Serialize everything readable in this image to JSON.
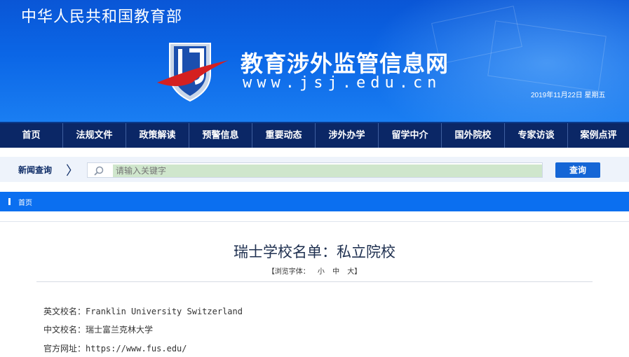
{
  "header": {
    "ministry": "中华人民共和国教育部",
    "site_title": "教育涉外监管信息网",
    "site_url": "www.jsj.edu.cn",
    "date": "2019年11月22日  星期五",
    "logo_icon": "jsj-logo-icon"
  },
  "nav": {
    "items": [
      "首页",
      "法规文件",
      "政策解读",
      "预警信息",
      "重要动态",
      "涉外办学",
      "留学中介",
      "国外院校",
      "专家访谈",
      "案例点评"
    ]
  },
  "search": {
    "label": "新闻查询",
    "placeholder": "请输入关键字",
    "button": "查询",
    "icon": "search-icon"
  },
  "breadcrumb": {
    "home": "首页"
  },
  "article": {
    "title": "瑞士学校名单：私立院校",
    "font_size_label": "【浏览字体：",
    "font_small": "小",
    "font_medium": "中",
    "font_large": "大】",
    "fields": [
      {
        "key": "英文校名：",
        "value": "Franklin University Switzerland"
      },
      {
        "key": "中文校名：",
        "value": "瑞士富兰克林大学"
      },
      {
        "key": "官方网址：",
        "value": "https://www.fus.edu/"
      }
    ]
  },
  "colors": {
    "banner": "#0b66e6",
    "nav": "#0b2766",
    "accent": "#0b6ff0",
    "button": "#1566d6"
  }
}
